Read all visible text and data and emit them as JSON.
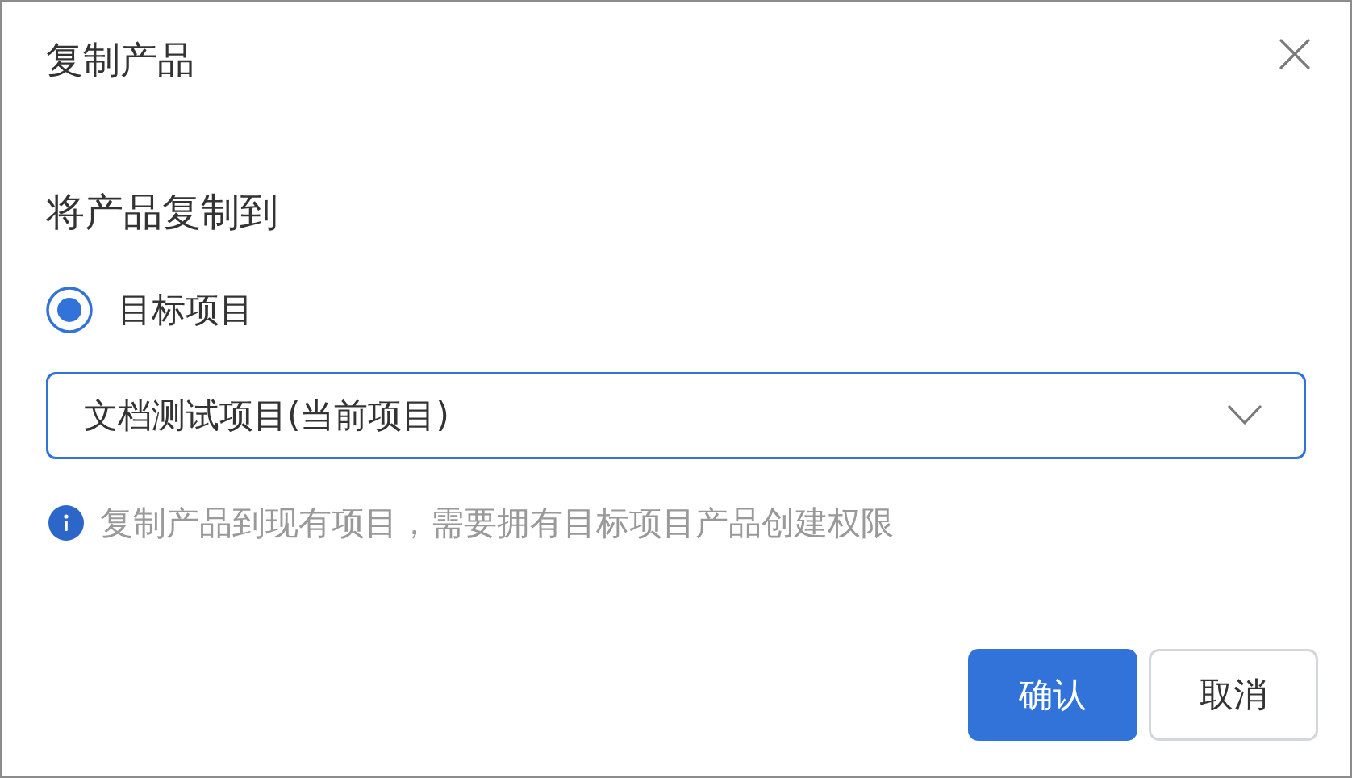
{
  "dialog": {
    "title": "复制产品"
  },
  "section_title": "将产品复制到",
  "options": [
    {
      "label": "目标项目",
      "selected": true
    }
  ],
  "project_select": {
    "value": "文档测试项目(当前项目)"
  },
  "hint": "复制产品到现有项目，需要拥有目标项目产品创建权限",
  "buttons": [
    {
      "label": "确认",
      "kind": "primary"
    },
    {
      "label": "取消",
      "kind": "secondary"
    }
  ]
}
